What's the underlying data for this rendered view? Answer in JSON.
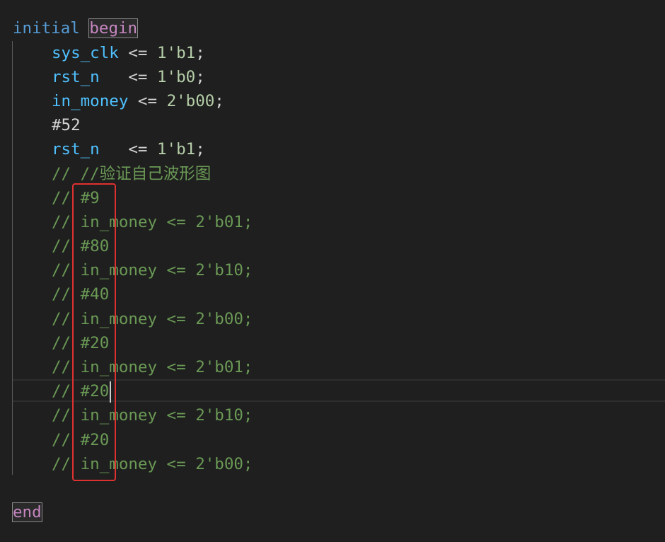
{
  "editor": {
    "lines": {
      "l1": {
        "kw": "initial",
        "kw2": "begin"
      },
      "l2": {
        "var": "sys_clk",
        "op": " <= ",
        "num": "1'b1",
        "punc": ";"
      },
      "l3": {
        "var": "rst_n",
        "op": "   <= ",
        "num": "1'b0",
        "punc": ";"
      },
      "l4": {
        "var": "in_money",
        "op": " <= ",
        "num": "2'b00",
        "punc": ";"
      },
      "l5": {
        "plain": "#52"
      },
      "l6": {
        "var": "rst_n",
        "op": "   <= ",
        "num": "1'b1",
        "punc": ";"
      },
      "l7": {
        "comment": "// //验证自己波形图"
      },
      "l8": {
        "comment": "// #9"
      },
      "l9": {
        "comment": "// in_money <= 2'b01;"
      },
      "l10": {
        "comment": "// #80"
      },
      "l11": {
        "comment": "// in_money <= 2'b10;"
      },
      "l12": {
        "comment": "// #40"
      },
      "l13": {
        "comment": "// in_money <= 2'b00;"
      },
      "l14": {
        "comment": "// #20"
      },
      "l15": {
        "comment": "// in_money <= 2'b01;"
      },
      "l16": {
        "comment": "// #20"
      },
      "l17": {
        "comment": "// in_money <= 2'b10;"
      },
      "l18": {
        "comment": "// #20"
      },
      "l19": {
        "comment": "// in_money <= 2'b00;"
      },
      "l21": {
        "kw": "end"
      }
    },
    "colors": {
      "background": "#1f1f1f",
      "keyword": "#569cd6",
      "control_keyword": "#c586c0",
      "variable": "#4fc1ff",
      "number": "#b5cea8",
      "comment": "#6a9955",
      "annotation_box": "#e03131"
    }
  }
}
